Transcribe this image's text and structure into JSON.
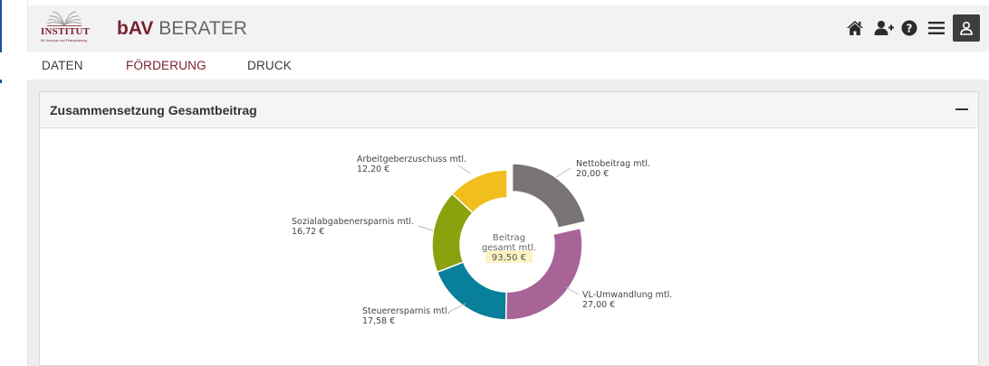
{
  "header": {
    "logo_text": "INSTITUT",
    "logo_subtext": "für Vorsorge und Finanzplanung",
    "title_strong": "bAV",
    "title_rest": " BERATER"
  },
  "toolbar": {
    "icons": [
      "home-icon",
      "add-user-icon",
      "help-icon",
      "menu-icon",
      "user-icon"
    ]
  },
  "nav": {
    "items": [
      {
        "label": "DATEN",
        "active": false
      },
      {
        "label": "FÖRDERUNG",
        "active": true
      },
      {
        "label": "DRUCK",
        "active": false
      }
    ]
  },
  "panel": {
    "title": "Zusammensetzung Gesamtbeitrag"
  },
  "chart_data": {
    "type": "pie",
    "donut": true,
    "center_label_line1": "Beitrag",
    "center_label_line2": "gesamt mtl.",
    "center_value": "93,50 €",
    "total": 93.5,
    "exploded": "Nettobeitrag mtl.",
    "slices": [
      {
        "label": "Nettobeitrag mtl.",
        "value": 20.0,
        "value_label": "20,00 €",
        "color": "#7a7375"
      },
      {
        "label": "VL-Umwandlung mtl.",
        "value": 27.0,
        "value_label": "27,00 €",
        "color": "#a86397"
      },
      {
        "label": "Steuerersparnis mtl.",
        "value": 17.58,
        "value_label": "17,58 €",
        "color": "#087f9b"
      },
      {
        "label": "Sozialabgabenersparnis mtl.",
        "value": 16.72,
        "value_label": "16,72 €",
        "color": "#8aa20e"
      },
      {
        "label": "Arbeitgeberzuschuss mtl.",
        "value": 12.2,
        "value_label": "12,20 €",
        "color": "#f2be1d"
      }
    ]
  }
}
